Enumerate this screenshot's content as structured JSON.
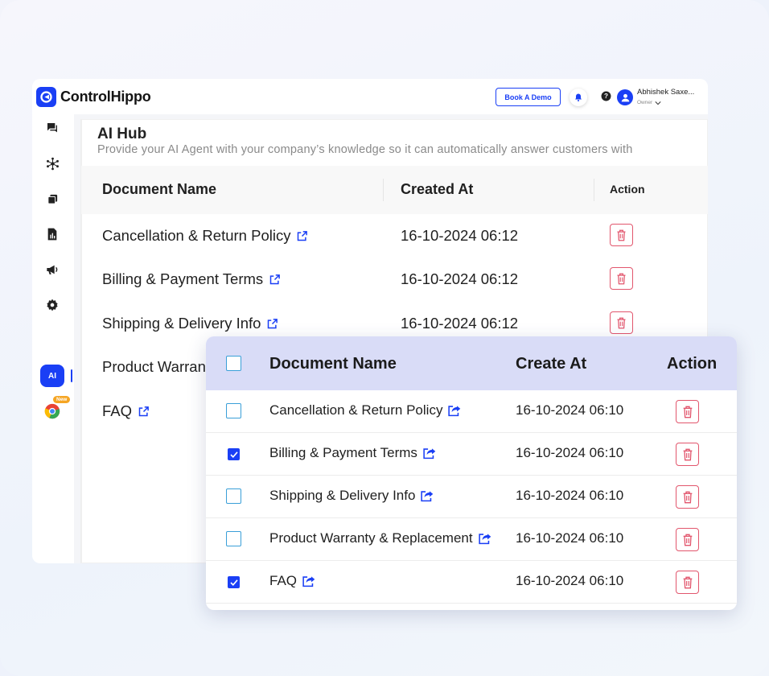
{
  "app": {
    "logo_text": "ControlHippo",
    "book_demo": "Book A Demo",
    "user_name": "Abhishek Saxe...",
    "user_role": "Owner"
  },
  "sidebar": {
    "ai_label": "AI",
    "new_badge": "New"
  },
  "page": {
    "title": "AI Hub",
    "subtitle": "Provide your AI Agent with your company’s knowledge so it can automatically answer customers with"
  },
  "back_table": {
    "headers": {
      "name": "Document Name",
      "created": "Created At",
      "action": "Action"
    },
    "rows": [
      {
        "name": "Cancellation & Return Policy",
        "date": "16-10-2024 06:12"
      },
      {
        "name": "Billing & Payment Terms",
        "date": "16-10-2024 06:12"
      },
      {
        "name": "Shipping & Delivery Info",
        "date": "16-10-2024 06:12"
      },
      {
        "name": "Product Warran",
        "date": ""
      },
      {
        "name": "FAQ",
        "date": ""
      }
    ]
  },
  "front_table": {
    "headers": {
      "name": "Document Name",
      "created": "Create At",
      "action": "Action"
    },
    "rows": [
      {
        "name": "Cancellation & Return Policy",
        "date": "16-10-2024 06:10",
        "checked": false
      },
      {
        "name": "Billing & Payment Terms",
        "date": "16-10-2024 06:10",
        "checked": true
      },
      {
        "name": "Shipping & Delivery Info",
        "date": "16-10-2024 06:10",
        "checked": false
      },
      {
        "name": "Product Warranty & Replacement",
        "date": "16-10-2024 06:10",
        "checked": false
      },
      {
        "name": "FAQ",
        "date": "16-10-2024 06:10",
        "checked": true
      }
    ]
  },
  "colors": {
    "brand": "#1a3ff5",
    "danger": "#e2566d",
    "header_bg": "#d9dcf7"
  },
  "icons": [
    "chat-icon",
    "network-icon",
    "copy-icon",
    "report-icon",
    "megaphone-icon",
    "gear-icon",
    "ai-icon",
    "chrome-icon",
    "bell-icon",
    "help-icon",
    "user-icon",
    "trash-icon",
    "external-link-icon",
    "share-icon"
  ]
}
